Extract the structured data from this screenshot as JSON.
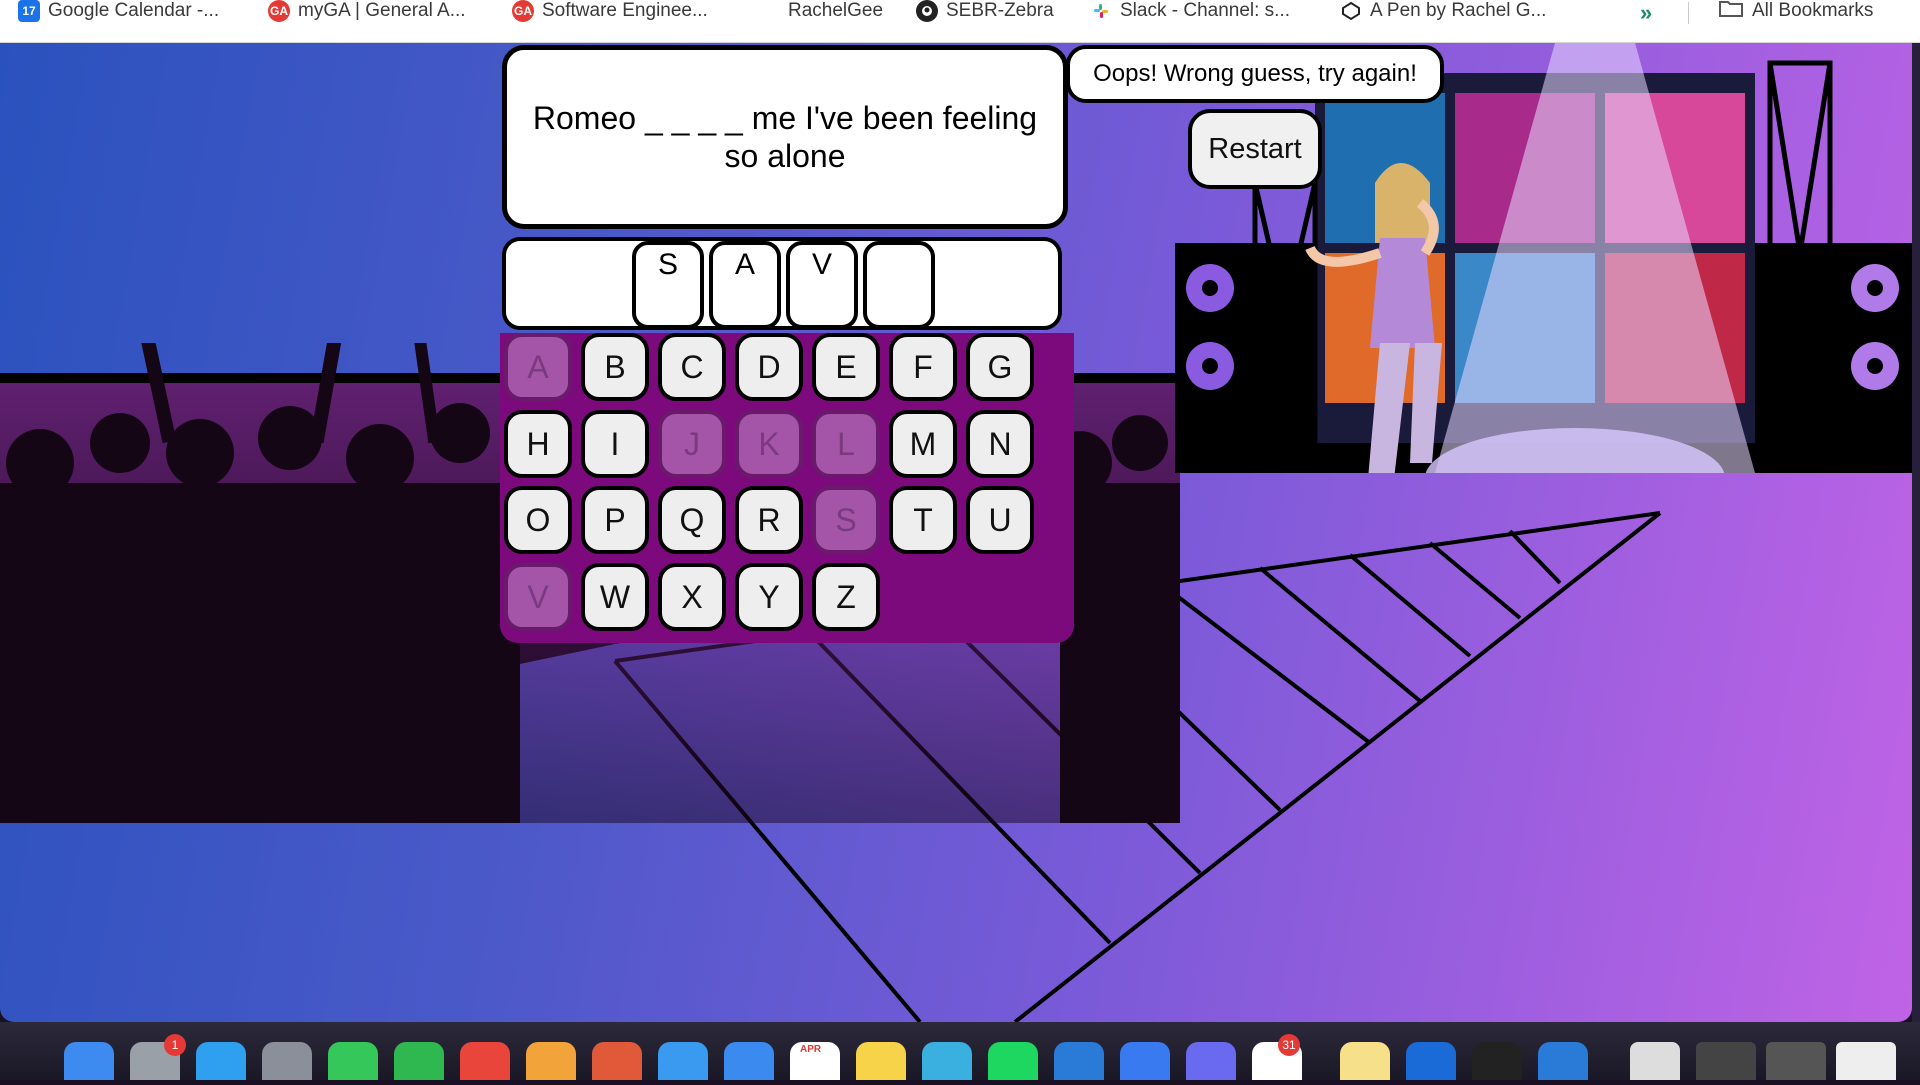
{
  "bookmarks": {
    "items": [
      {
        "label": "Google Calendar -...",
        "icon": "calendar-icon",
        "badge": "17"
      },
      {
        "label": "myGA | General A...",
        "icon": "ga-logo-icon",
        "badge": "GA"
      },
      {
        "label": "Software Enginee...",
        "icon": "ga-logo-icon",
        "badge": "GA"
      },
      {
        "label": "RachelGee",
        "icon": "",
        "badge": ""
      },
      {
        "label": "SEBR-Zebra",
        "icon": "github-icon",
        "badge": ""
      },
      {
        "label": "Slack - Channel: s...",
        "icon": "slack-icon",
        "badge": ""
      },
      {
        "label": "A Pen by Rachel G...",
        "icon": "codepen-icon",
        "badge": ""
      }
    ],
    "more": "»",
    "all_bookmarks": "All Bookmarks"
  },
  "game": {
    "lyric": "Romeo _ _ _ _ me I've been feeling so alone",
    "guessed_slots": [
      "S",
      "A",
      "V",
      ""
    ],
    "message": "Oops! Wrong guess, try again!",
    "restart_label": "Restart",
    "keys": [
      {
        "letter": "A",
        "used": true
      },
      {
        "letter": "B",
        "used": false
      },
      {
        "letter": "C",
        "used": false
      },
      {
        "letter": "D",
        "used": false
      },
      {
        "letter": "E",
        "used": false
      },
      {
        "letter": "F",
        "used": false
      },
      {
        "letter": "G",
        "used": false
      },
      {
        "letter": "H",
        "used": false
      },
      {
        "letter": "I",
        "used": false
      },
      {
        "letter": "J",
        "used": true
      },
      {
        "letter": "K",
        "used": true
      },
      {
        "letter": "L",
        "used": true
      },
      {
        "letter": "M",
        "used": false
      },
      {
        "letter": "N",
        "used": false
      },
      {
        "letter": "O",
        "used": false
      },
      {
        "letter": "P",
        "used": false
      },
      {
        "letter": "Q",
        "used": false
      },
      {
        "letter": "R",
        "used": false
      },
      {
        "letter": "S",
        "used": true
      },
      {
        "letter": "T",
        "used": false
      },
      {
        "letter": "U",
        "used": false
      },
      {
        "letter": "V",
        "used": true
      },
      {
        "letter": "W",
        "used": false
      },
      {
        "letter": "X",
        "used": false
      },
      {
        "letter": "Y",
        "used": false
      },
      {
        "letter": "Z",
        "used": false
      }
    ]
  },
  "dock": {
    "badges": [
      "1",
      "31"
    ],
    "calendar_month": "APR"
  },
  "colors": {
    "keyboard_bg": "#7d0a7d",
    "used_key": "#a455a8",
    "accent": "#8a4fe0"
  }
}
